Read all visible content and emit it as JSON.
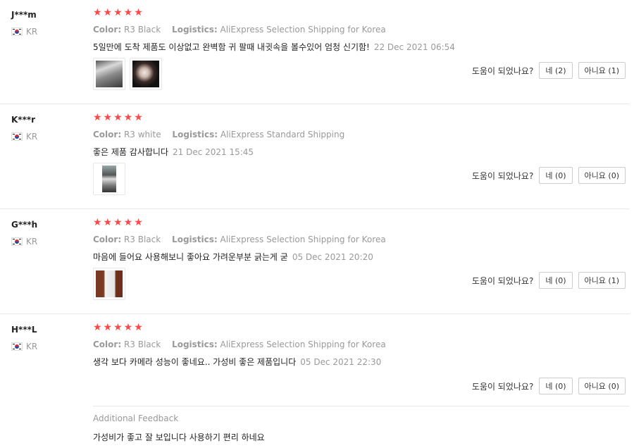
{
  "reviews": [
    {
      "user": "J***m",
      "country": "KR",
      "stars": "★★★★★",
      "color_label": "Color:",
      "color_value": "R3 Black",
      "logistics_label": "Logistics:",
      "logistics_value": "AliExpress Selection Shipping for Korea",
      "text": "5일만에 도착 제품도 이상없고 완벽함 귀 팔때 내귓속을 볼수있어 엄청 신기함!",
      "date": "22 Dec 2021 06:54",
      "helpful_label": "도움이 되었나요?",
      "yes_label": "네 (2)",
      "no_label": "아니요 (1)"
    },
    {
      "user": "K***r",
      "country": "KR",
      "stars": "★★★★★",
      "color_label": "Color:",
      "color_value": "R3 white",
      "logistics_label": "Logistics:",
      "logistics_value": "AliExpress Standard Shipping",
      "text": "좋은 제품 감사합니다",
      "date": "21 Dec 2021 15:45",
      "helpful_label": "도움이 되었나요?",
      "yes_label": "네 (0)",
      "no_label": "아니요 (0)"
    },
    {
      "user": "G***h",
      "country": "KR",
      "stars": "★★★★★",
      "color_label": "Color:",
      "color_value": "R3 Black",
      "logistics_label": "Logistics:",
      "logistics_value": "AliExpress Selection Shipping for Korea",
      "text": "마음에 들어요 사용해보니 좋아요 가려운부분 긁는게 굳",
      "date": "05 Dec 2021 20:20",
      "helpful_label": "도움이 되었나요?",
      "yes_label": "네 (0)",
      "no_label": "아니요 (1)"
    },
    {
      "user": "H***L",
      "country": "KR",
      "stars": "★★★★★",
      "color_label": "Color:",
      "color_value": "R3 Black",
      "logistics_label": "Logistics:",
      "logistics_value": "AliExpress Selection Shipping for Korea",
      "text": "생각 보다 카메라 성능이 좋네요.. 가성비 좋은 제품입니다",
      "date": "05 Dec 2021 22:30",
      "helpful_label": "도움이 되었나요?",
      "yes_label": "네 (0)",
      "no_label": "아니요 (0)",
      "additional_title": "Additional Feedback",
      "additional_text": "가성비가 좋고 잘 보입니다 사용하기 편리 하네요"
    }
  ]
}
